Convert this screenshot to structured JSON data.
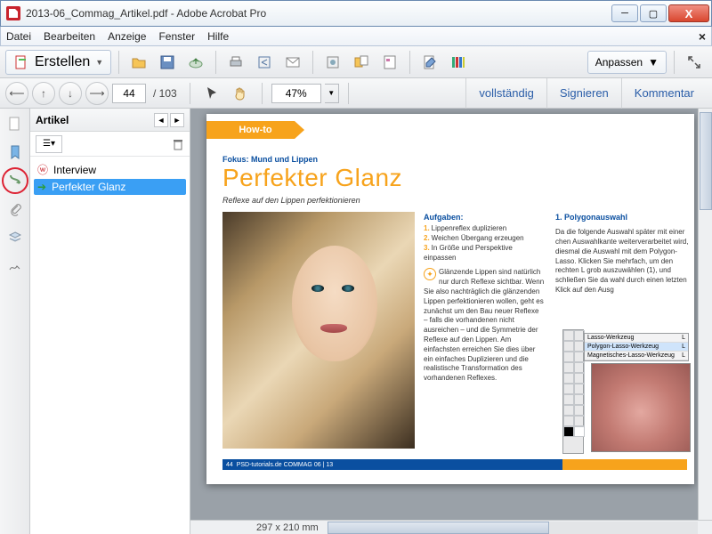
{
  "window": {
    "title": "2013-06_Commag_Artikel.pdf - Adobe Acrobat Pro"
  },
  "menu": {
    "items": [
      "Datei",
      "Bearbeiten",
      "Anzeige",
      "Fenster",
      "Hilfe"
    ]
  },
  "toolbar": {
    "create_label": "Erstellen",
    "customize_label": "Anpassen"
  },
  "nav": {
    "page_current": "44",
    "page_total": "/  103",
    "zoom": "47%",
    "actions": {
      "vollstaendig": "vollständig",
      "signieren": "Signieren",
      "kommentar": "Kommentar"
    }
  },
  "panel": {
    "title": "Artikel",
    "items": [
      {
        "label": "Interview",
        "selected": false
      },
      {
        "label": "Perfekter Glanz",
        "selected": true
      }
    ]
  },
  "doc": {
    "howto": "How-to",
    "fokus": "Fokus: Mund und Lippen",
    "headline": "Perfekter Glanz",
    "sub": "Reflexe auf den Lippen perfektionieren",
    "aufgaben_h": "Aufgaben:",
    "aufgaben": [
      "Lippenreflex duplizieren",
      "Weichen Übergang erzeugen",
      "In Größe und Perspektive einpassen"
    ],
    "para1": "Glänzende Lippen sind natürlich nur durch Reflexe sichtbar. Wenn Sie also nachträglich die glänzenden Lippen perfektionieren wollen, geht es zunächst um den Bau neuer Reflexe – falls die vorhandenen nicht ausreichen – und die Symmetrie der Reflexe auf den Lippen. Am einfachsten erreichen Sie dies über ein einfaches Duplizieren und die realistische Transformation des vorhandenen Reflexes.",
    "poly_h": "1. Polygonauswahl",
    "poly_p": "Da die folgende Auswahl später mit einer chen Auswahlkante weiterverarbeitet wird, diesmal die Auswahl mit dem Polygon-Lasso. Klicken Sie mehrfach, um den rechten L grob auszuwählen (1), und schließen Sie da wahl durch einen letzten Klick auf den Ausg",
    "tool_menu": [
      "Lasso-Werkzeug",
      "Polygon-Lasso-Werkzeug",
      "Magnetisches-Lasso-Werkzeug"
    ],
    "tool_key": "L",
    "page_num": "44",
    "footer_text": "PSD-tutorials.de   COMMAG 06 | 13"
  },
  "status": {
    "dimensions": "297 x 210 mm"
  }
}
